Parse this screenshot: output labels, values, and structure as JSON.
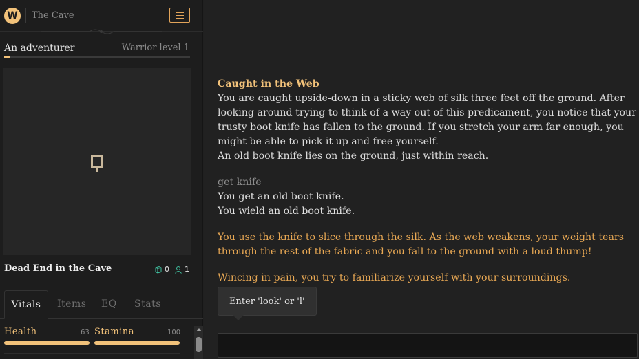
{
  "app": {
    "title": "The Cave",
    "logo_letter": "W"
  },
  "character": {
    "name": "An adventurer",
    "level": "Warrior level 1",
    "xp_fraction": 0.03
  },
  "room": {
    "name": "Dead End in the Cave",
    "items_count": "0",
    "players_count": "1"
  },
  "tabs": [
    {
      "label": "Vitals",
      "active": true
    },
    {
      "label": "Items",
      "active": false
    },
    {
      "label": "EQ",
      "active": false
    },
    {
      "label": "Stats",
      "active": false
    }
  ],
  "vitals": {
    "health": {
      "label": "Health",
      "value": "63",
      "fraction": 1.0
    },
    "stamina": {
      "label": "Stamina",
      "value": "100",
      "fraction": 1.0
    }
  },
  "log": {
    "room_title": "Caught in the Web",
    "room_desc": "You are caught upside-down in a sticky web of silk three feet off the ground. After looking around trying to think of a way out of this predicament, you notice that your trusty boot knife has fallen to the ground. If you stretch your arm far enough, you might be able to pick it up and free yourself.",
    "room_item": "An old boot knife lies on the ground, just within reach.",
    "command": "get knife",
    "result_1": "You get an old boot knife.",
    "result_2": "You wield an old boot knife.",
    "story_1": "You use the knife to slice through the silk. As the web weakens, your weight tears through the rest of the fabric and you fall to the ground with a loud thump!",
    "story_2": "Wincing in pain, you try to familiarize yourself with your surroundings."
  },
  "hint": {
    "text": "Enter 'look' or 'l'"
  },
  "input": {
    "value": "",
    "placeholder": ""
  },
  "colors": {
    "accent": "#f2c27a",
    "story": "#e8a854",
    "background": "#202020"
  }
}
